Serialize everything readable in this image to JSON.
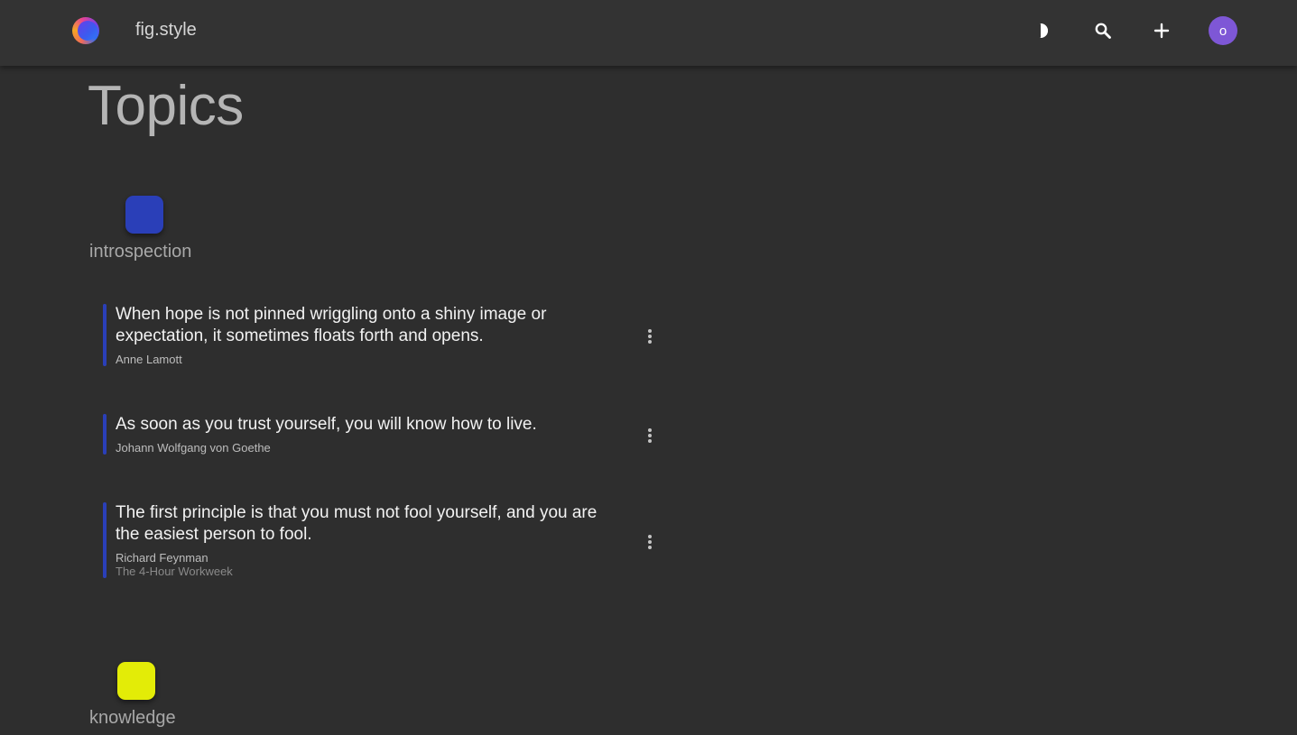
{
  "header": {
    "brand": "fig.style",
    "icons": {
      "theme_toggle": "half-moon-icon",
      "search": "search-icon",
      "add": "plus-icon"
    },
    "avatar_letter": "o",
    "avatar_color": "#7e57d6"
  },
  "page": {
    "title": "Topics"
  },
  "topics": [
    {
      "name": "introspection",
      "color": "#2a3fb8",
      "quotes": [
        {
          "text": "When hope is not pinned wriggling onto a shiny image or expectation, it sometimes floats forth and opens.",
          "author": "Anne Lamott",
          "source": ""
        },
        {
          "text": "As soon as you trust yourself, you will know how to live.",
          "author": "Johann Wolfgang von Goethe",
          "source": ""
        },
        {
          "text": "The first principle is that you must not fool yourself, and you are the easiest person to fool.",
          "author": "Richard Feynman",
          "source": "The 4-Hour Workweek"
        }
      ]
    },
    {
      "name": "knowledge",
      "color": "#e3ec07",
      "quotes": []
    }
  ]
}
